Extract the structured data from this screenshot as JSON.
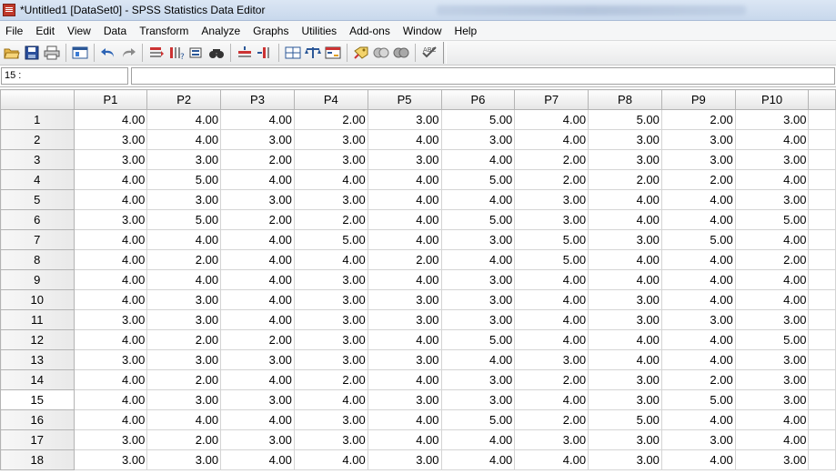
{
  "window": {
    "title": "*Untitled1 [DataSet0] - SPSS Statistics Data Editor"
  },
  "menu": [
    "File",
    "Edit",
    "View",
    "Data",
    "Transform",
    "Analyze",
    "Graphs",
    "Utilities",
    "Add-ons",
    "Window",
    "Help"
  ],
  "toolbar": {
    "icons": [
      "open-folder-icon",
      "save-icon",
      "print-icon",
      "dialog-recall-icon",
      "undo-icon",
      "redo-icon",
      "goto-case-icon",
      "goto-variable-icon",
      "variables-icon",
      "find-icon",
      "insert-cases-icon",
      "insert-variable-icon",
      "split-file-icon",
      "weight-cases-icon",
      "select-cases-icon",
      "value-labels-icon",
      "use-sets-icon",
      "show-all-icon",
      "spell-check-icon"
    ]
  },
  "cell_editor": {
    "reference": "15 :",
    "value": ""
  },
  "grid": {
    "columns": [
      "P1",
      "P2",
      "P3",
      "P4",
      "P5",
      "P6",
      "P7",
      "P8",
      "P9",
      "P10"
    ],
    "selected_row": 15,
    "rows": [
      {
        "n": "1",
        "v": [
          "4.00",
          "4.00",
          "4.00",
          "2.00",
          "3.00",
          "5.00",
          "4.00",
          "5.00",
          "2.00",
          "3.00"
        ]
      },
      {
        "n": "2",
        "v": [
          "3.00",
          "4.00",
          "3.00",
          "3.00",
          "4.00",
          "3.00",
          "4.00",
          "3.00",
          "3.00",
          "4.00"
        ]
      },
      {
        "n": "3",
        "v": [
          "3.00",
          "3.00",
          "2.00",
          "3.00",
          "3.00",
          "4.00",
          "2.00",
          "3.00",
          "3.00",
          "3.00"
        ]
      },
      {
        "n": "4",
        "v": [
          "4.00",
          "5.00",
          "4.00",
          "4.00",
          "4.00",
          "5.00",
          "2.00",
          "2.00",
          "2.00",
          "4.00"
        ]
      },
      {
        "n": "5",
        "v": [
          "4.00",
          "3.00",
          "3.00",
          "3.00",
          "4.00",
          "4.00",
          "3.00",
          "4.00",
          "4.00",
          "3.00"
        ]
      },
      {
        "n": "6",
        "v": [
          "3.00",
          "5.00",
          "2.00",
          "2.00",
          "4.00",
          "5.00",
          "3.00",
          "4.00",
          "4.00",
          "5.00"
        ]
      },
      {
        "n": "7",
        "v": [
          "4.00",
          "4.00",
          "4.00",
          "5.00",
          "4.00",
          "3.00",
          "5.00",
          "3.00",
          "5.00",
          "4.00"
        ]
      },
      {
        "n": "8",
        "v": [
          "4.00",
          "2.00",
          "4.00",
          "4.00",
          "2.00",
          "4.00",
          "5.00",
          "4.00",
          "4.00",
          "2.00"
        ]
      },
      {
        "n": "9",
        "v": [
          "4.00",
          "4.00",
          "4.00",
          "3.00",
          "4.00",
          "3.00",
          "4.00",
          "4.00",
          "4.00",
          "4.00"
        ]
      },
      {
        "n": "10",
        "v": [
          "4.00",
          "3.00",
          "4.00",
          "3.00",
          "3.00",
          "3.00",
          "4.00",
          "3.00",
          "4.00",
          "4.00"
        ]
      },
      {
        "n": "11",
        "v": [
          "3.00",
          "3.00",
          "4.00",
          "3.00",
          "3.00",
          "3.00",
          "4.00",
          "3.00",
          "3.00",
          "3.00"
        ]
      },
      {
        "n": "12",
        "v": [
          "4.00",
          "2.00",
          "2.00",
          "3.00",
          "4.00",
          "5.00",
          "4.00",
          "4.00",
          "4.00",
          "5.00"
        ]
      },
      {
        "n": "13",
        "v": [
          "3.00",
          "3.00",
          "3.00",
          "3.00",
          "3.00",
          "4.00",
          "3.00",
          "4.00",
          "4.00",
          "3.00"
        ]
      },
      {
        "n": "14",
        "v": [
          "4.00",
          "2.00",
          "4.00",
          "2.00",
          "4.00",
          "3.00",
          "2.00",
          "3.00",
          "2.00",
          "3.00"
        ]
      },
      {
        "n": "15",
        "v": [
          "4.00",
          "3.00",
          "3.00",
          "4.00",
          "3.00",
          "3.00",
          "4.00",
          "3.00",
          "5.00",
          "3.00"
        ]
      },
      {
        "n": "16",
        "v": [
          "4.00",
          "4.00",
          "4.00",
          "3.00",
          "4.00",
          "5.00",
          "2.00",
          "5.00",
          "4.00",
          "4.00"
        ]
      },
      {
        "n": "17",
        "v": [
          "3.00",
          "2.00",
          "3.00",
          "3.00",
          "4.00",
          "4.00",
          "3.00",
          "3.00",
          "3.00",
          "4.00"
        ]
      },
      {
        "n": "18",
        "v": [
          "3.00",
          "3.00",
          "4.00",
          "4.00",
          "3.00",
          "4.00",
          "4.00",
          "3.00",
          "4.00",
          "3.00"
        ]
      }
    ]
  }
}
